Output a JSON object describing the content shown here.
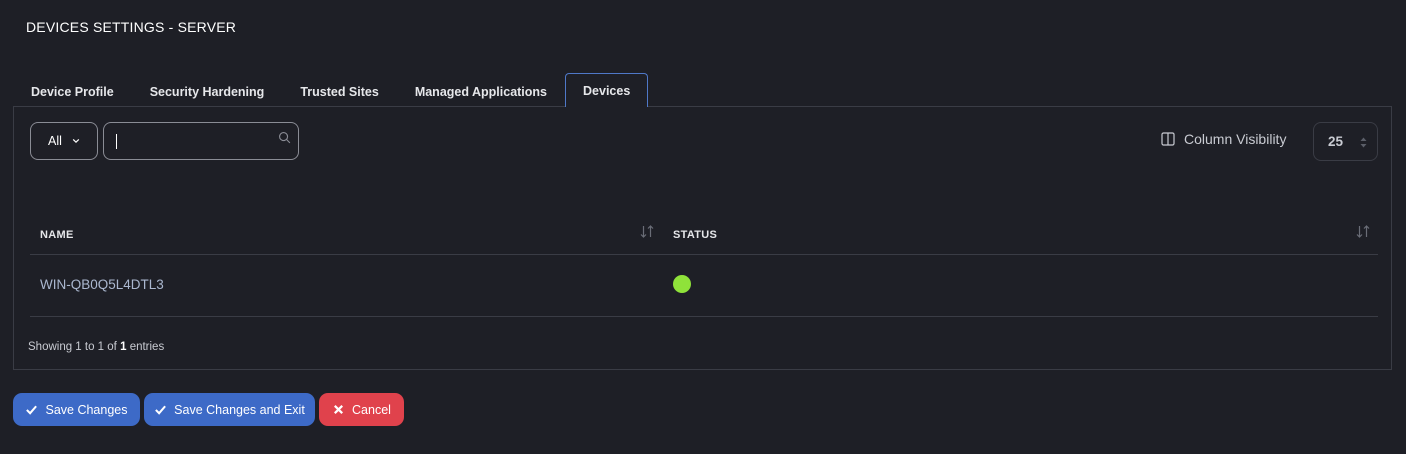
{
  "page": {
    "title": "DEVICES SETTINGS - SERVER"
  },
  "tabs": [
    {
      "label": "Device Profile",
      "active": false
    },
    {
      "label": "Security Hardening",
      "active": false
    },
    {
      "label": "Trusted Sites",
      "active": false
    },
    {
      "label": "Managed Applications",
      "active": false
    },
    {
      "label": "Devices",
      "active": true
    }
  ],
  "toolbar": {
    "filter_value": "All",
    "search_value": "",
    "column_visibility_label": "Column Visibility",
    "page_length": "25"
  },
  "table": {
    "columns": [
      "NAME",
      "STATUS"
    ],
    "rows": [
      {
        "name": "WIN-QB0Q5L4DTL3",
        "status": "online"
      }
    ],
    "info": {
      "prefix": "Showing 1 to 1 of",
      "total": "1",
      "suffix": "entries"
    }
  },
  "actions": {
    "save_label": "Save Changes",
    "save_exit_label": "Save Changes and Exit",
    "cancel_label": "Cancel"
  },
  "colors": {
    "background": "#1e1f26",
    "active_tab_border": "#4f78c8",
    "primary_button": "#3d6ac7",
    "danger_button": "#e0424c",
    "status_online": "#8fe23a",
    "row_link_text": "#aab7cf"
  },
  "icons": {
    "search": "search-icon",
    "column_visibility": "column-visibility-icon",
    "sort": "sort-icon",
    "check": "check-icon",
    "close": "close-icon",
    "chevron": "chevron-down-icon"
  }
}
